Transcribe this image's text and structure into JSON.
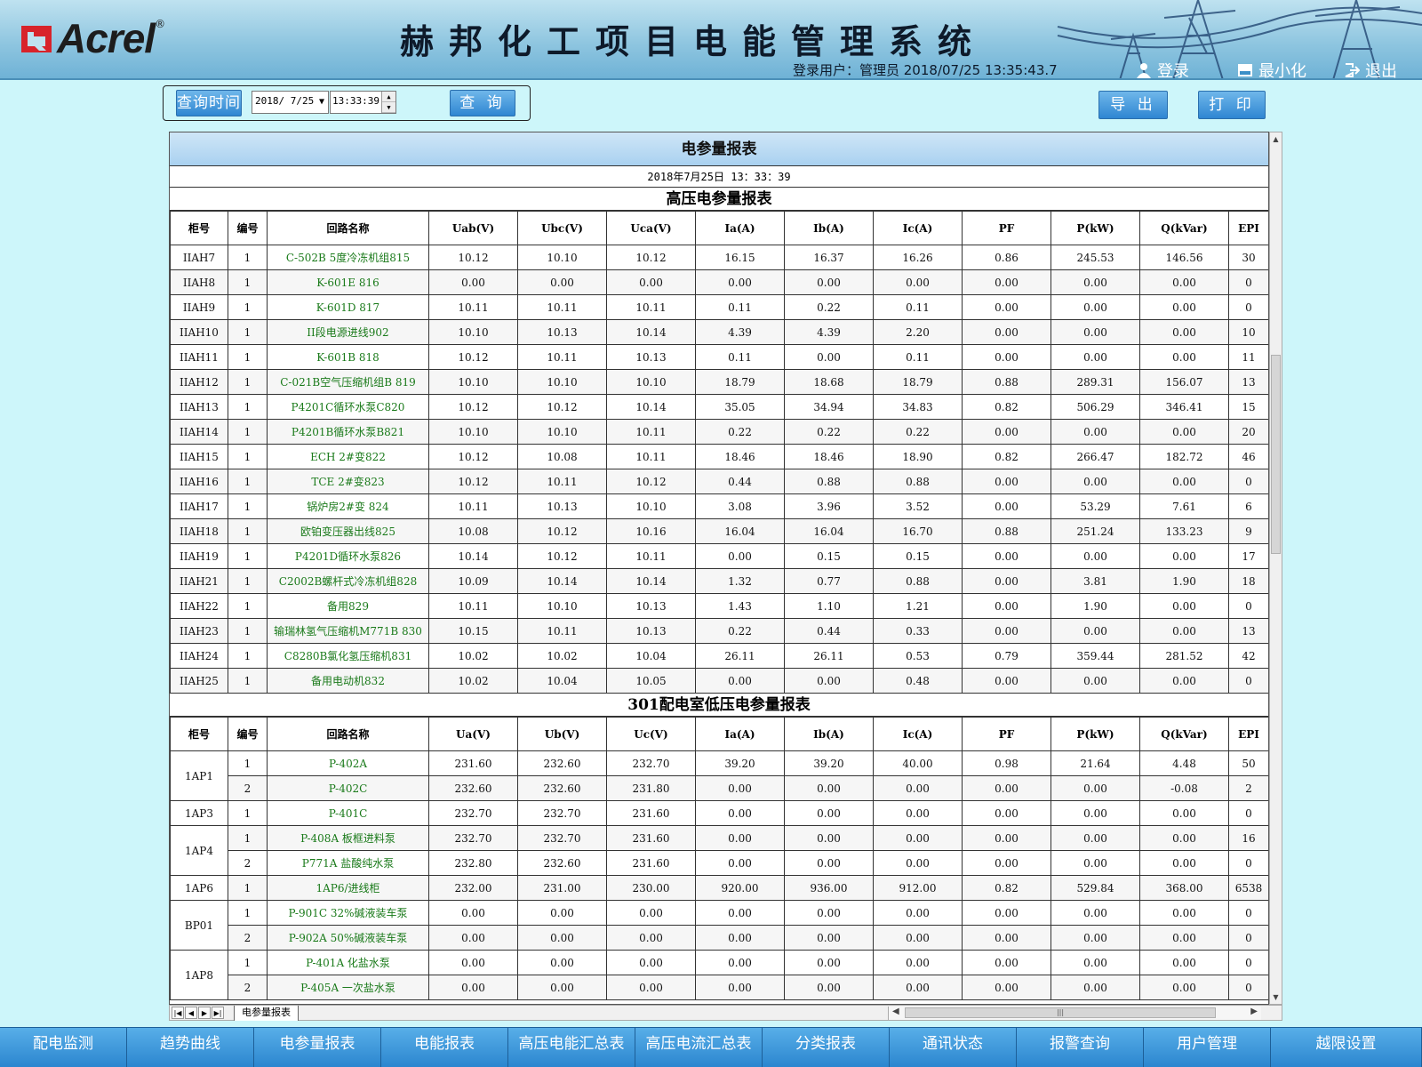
{
  "header": {
    "logo_text": "Acrel",
    "title": "赫邦化工项目电能管理系统",
    "login_info": "登录用户：管理员   2018/07/25   13:35:43.7",
    "login_label": "登录",
    "minimize_label": "最小化",
    "exit_label": "退出"
  },
  "query": {
    "label": "查询时间",
    "date": "2018/ 7/25",
    "time": "13:33:39",
    "query_label": "查 询"
  },
  "actions": {
    "export_label": "导 出",
    "print_label": "打 印"
  },
  "report": {
    "title": "电参量报表",
    "datetime": "2018年7月25日  13：33：39",
    "hv": {
      "title": "高压电参量报表",
      "headers": [
        "柜号",
        "编号",
        "回路名称",
        "Uab(V)",
        "Ubc(V)",
        "Uca(V)",
        "Ia(A)",
        "Ib(A)",
        "Ic(A)",
        "PF",
        "P(kW)",
        "Q(kVar)",
        "EPI"
      ],
      "rows": [
        [
          "IIAH7",
          "1",
          "C-502B 5度冷冻机组815",
          "10.12",
          "10.10",
          "10.12",
          "16.15",
          "16.37",
          "16.26",
          "0.86",
          "245.53",
          "146.56",
          "30"
        ],
        [
          "IIAH8",
          "1",
          "K-601E 816",
          "0.00",
          "0.00",
          "0.00",
          "0.00",
          "0.00",
          "0.00",
          "0.00",
          "0.00",
          "0.00",
          "0"
        ],
        [
          "IIAH9",
          "1",
          "K-601D 817",
          "10.11",
          "10.11",
          "10.11",
          "0.11",
          "0.22",
          "0.11",
          "0.00",
          "0.00",
          "0.00",
          "0"
        ],
        [
          "IIAH10",
          "1",
          "II段电源进线902",
          "10.10",
          "10.13",
          "10.14",
          "4.39",
          "4.39",
          "2.20",
          "0.00",
          "0.00",
          "0.00",
          "10"
        ],
        [
          "IIAH11",
          "1",
          "K-601B 818",
          "10.12",
          "10.11",
          "10.13",
          "0.11",
          "0.00",
          "0.11",
          "0.00",
          "0.00",
          "0.00",
          "11"
        ],
        [
          "IIAH12",
          "1",
          "C-021B空气压缩机组B 819",
          "10.10",
          "10.10",
          "10.10",
          "18.79",
          "18.68",
          "18.79",
          "0.88",
          "289.31",
          "156.07",
          "13"
        ],
        [
          "IIAH13",
          "1",
          "P4201C循环水泵C820",
          "10.12",
          "10.12",
          "10.14",
          "35.05",
          "34.94",
          "34.83",
          "0.82",
          "506.29",
          "346.41",
          "15"
        ],
        [
          "IIAH14",
          "1",
          "P4201B循环水泵B821",
          "10.10",
          "10.10",
          "10.11",
          "0.22",
          "0.22",
          "0.22",
          "0.00",
          "0.00",
          "0.00",
          "20"
        ],
        [
          "IIAH15",
          "1",
          "ECH 2#变822",
          "10.12",
          "10.08",
          "10.11",
          "18.46",
          "18.46",
          "18.90",
          "0.82",
          "266.47",
          "182.72",
          "46"
        ],
        [
          "IIAH16",
          "1",
          "TCE 2#变823",
          "10.12",
          "10.11",
          "10.12",
          "0.44",
          "0.88",
          "0.88",
          "0.00",
          "0.00",
          "0.00",
          "0"
        ],
        [
          "IIAH17",
          "1",
          "锅炉房2#变 824",
          "10.11",
          "10.13",
          "10.10",
          "3.08",
          "3.96",
          "3.52",
          "0.00",
          "53.29",
          "7.61",
          "6"
        ],
        [
          "IIAH18",
          "1",
          "欧铂变压器出线825",
          "10.08",
          "10.12",
          "10.16",
          "16.04",
          "16.04",
          "16.70",
          "0.88",
          "251.24",
          "133.23",
          "9"
        ],
        [
          "IIAH19",
          "1",
          "P4201D循环水泵826",
          "10.14",
          "10.12",
          "10.11",
          "0.00",
          "0.15",
          "0.15",
          "0.00",
          "0.00",
          "0.00",
          "17"
        ],
        [
          "IIAH21",
          "1",
          "C2002B螺杆式冷冻机组828",
          "10.09",
          "10.14",
          "10.14",
          "1.32",
          "0.77",
          "0.88",
          "0.00",
          "3.81",
          "1.90",
          "18"
        ],
        [
          "IIAH22",
          "1",
          "备用829",
          "10.11",
          "10.10",
          "10.13",
          "1.43",
          "1.10",
          "1.21",
          "0.00",
          "1.90",
          "0.00",
          "0"
        ],
        [
          "IIAH23",
          "1",
          "输瑞林氢气压缩机M771B 830",
          "10.15",
          "10.11",
          "10.13",
          "0.22",
          "0.44",
          "0.33",
          "0.00",
          "0.00",
          "0.00",
          "13"
        ],
        [
          "IIAH24",
          "1",
          "C8280B氯化氢压缩机831",
          "10.02",
          "10.02",
          "10.04",
          "26.11",
          "26.11",
          "0.53",
          "0.79",
          "359.44",
          "281.52",
          "42"
        ],
        [
          "IIAH25",
          "1",
          "备用电动机832",
          "10.02",
          "10.04",
          "10.05",
          "0.00",
          "0.00",
          "0.48",
          "0.00",
          "0.00",
          "0.00",
          "0"
        ]
      ]
    },
    "lv": {
      "title": "301配电室低压电参量报表",
      "headers": [
        "柜号",
        "编号",
        "回路名称",
        "Ua(V)",
        "Ub(V)",
        "Uc(V)",
        "Ia(A)",
        "Ib(A)",
        "Ic(A)",
        "PF",
        "P(kW)",
        "Q(kVar)",
        "EPI"
      ],
      "groups": [
        {
          "cab": "1AP1",
          "rows": [
            [
              "1",
              "P-402A",
              "231.60",
              "232.60",
              "232.70",
              "39.20",
              "39.20",
              "40.00",
              "0.98",
              "21.64",
              "4.48",
              "50"
            ],
            [
              "2",
              "P-402C",
              "232.60",
              "232.60",
              "231.80",
              "0.00",
              "0.00",
              "0.00",
              "0.00",
              "0.00",
              "-0.08",
              "2"
            ]
          ]
        },
        {
          "cab": "1AP3",
          "rows": [
            [
              "1",
              "P-401C",
              "232.70",
              "232.70",
              "231.60",
              "0.00",
              "0.00",
              "0.00",
              "0.00",
              "0.00",
              "0.00",
              "0"
            ]
          ]
        },
        {
          "cab": "1AP4",
          "rows": [
            [
              "1",
              "P-408A 板框进料泵",
              "232.70",
              "232.70",
              "231.60",
              "0.00",
              "0.00",
              "0.00",
              "0.00",
              "0.00",
              "0.00",
              "16"
            ],
            [
              "2",
              "P771A  盐酸纯水泵",
              "232.80",
              "232.60",
              "231.60",
              "0.00",
              "0.00",
              "0.00",
              "0.00",
              "0.00",
              "0.00",
              "0"
            ]
          ]
        },
        {
          "cab": "1AP6",
          "rows": [
            [
              "1",
              "1AP6/进线柜",
              "232.00",
              "231.00",
              "230.00",
              "920.00",
              "936.00",
              "912.00",
              "0.82",
              "529.84",
              "368.00",
              "6538"
            ]
          ]
        },
        {
          "cab": "BP01",
          "rows": [
            [
              "1",
              "P-901C 32%碱液装车泵",
              "0.00",
              "0.00",
              "0.00",
              "0.00",
              "0.00",
              "0.00",
              "0.00",
              "0.00",
              "0.00",
              "0"
            ],
            [
              "2",
              "P-902A 50%碱液装车泵",
              "0.00",
              "0.00",
              "0.00",
              "0.00",
              "0.00",
              "0.00",
              "0.00",
              "0.00",
              "0.00",
              "0"
            ]
          ]
        },
        {
          "cab": "1AP8",
          "rows": [
            [
              "1",
              "P-401A 化盐水泵",
              "0.00",
              "0.00",
              "0.00",
              "0.00",
              "0.00",
              "0.00",
              "0.00",
              "0.00",
              "0.00",
              "0"
            ],
            [
              "2",
              "P-405A 一次盐水泵",
              "0.00",
              "0.00",
              "0.00",
              "0.00",
              "0.00",
              "0.00",
              "0.00",
              "0.00",
              "0.00",
              "0"
            ]
          ]
        }
      ]
    }
  },
  "sheet_tab": "电参量报表",
  "bottom_nav": [
    "配电监测",
    "趋势曲线",
    "电参量报表",
    "电能报表",
    "高压电能汇总表",
    "高压电流汇总表",
    "分类报表",
    "通讯状态",
    "报警查询",
    "用户管理",
    "越限设置"
  ],
  "colors": {
    "nav_blue": "#2b86cf",
    "name_green": "#1a7a1a",
    "page_bg": "#cdf6fa"
  }
}
